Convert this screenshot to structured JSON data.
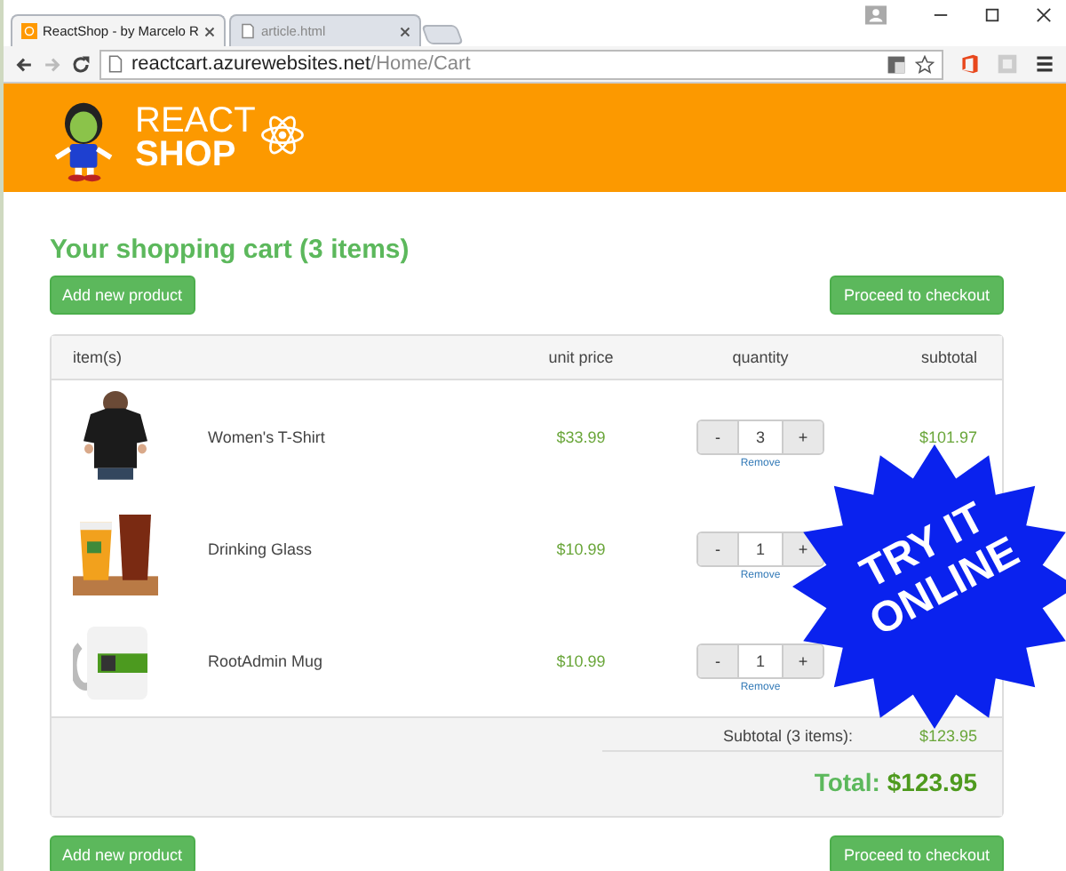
{
  "browser": {
    "tabs": [
      {
        "title": "ReactShop - by Marcelo R",
        "selected": true
      },
      {
        "title": "article.html",
        "selected": false
      }
    ],
    "address": {
      "host": "reactcart.azurewebsites.net",
      "path": "/Home/Cart"
    }
  },
  "header": {
    "logo_line_1": "REACT",
    "logo_line_2": "SHOP"
  },
  "cart": {
    "title": "Your shopping cart (3 items)",
    "top_buttons": [
      {
        "kind": "add",
        "label": "Add new product"
      },
      {
        "kind": "checkout",
        "label": "Proceed to checkout"
      }
    ],
    "columns": [
      "item(s)",
      "unit price",
      "quantity",
      "subtotal"
    ],
    "rows": [
      {
        "kind": "shirt",
        "name": "Women's T-Shirt",
        "price": "$33.99",
        "decrement": "-",
        "quantity": "3",
        "increment": "+",
        "remove": "Remove",
        "subtotal": "$101.97"
      },
      {
        "kind": "glass",
        "name": "Drinking Glass",
        "price": "$10.99",
        "decrement": "-",
        "quantity": "1",
        "increment": "+",
        "remove": "Remove"
      },
      {
        "kind": "mug",
        "name": "RootAdmin Mug",
        "price": "$10.99",
        "decrement": "-",
        "quantity": "1",
        "increment": "+",
        "remove": "Remove"
      }
    ],
    "subtotal_label": "Subtotal (3 items):",
    "subtotal_value": "$123.95",
    "total_label": "Total:",
    "total_value": "$123.95",
    "bottom_buttons": [
      {
        "kind": "add",
        "label": "Add new product"
      },
      {
        "kind": "checkout",
        "label": "Proceed to checkout"
      }
    ]
  },
  "badge": {
    "line_1": "TRY IT",
    "line_2": "ONLINE"
  }
}
